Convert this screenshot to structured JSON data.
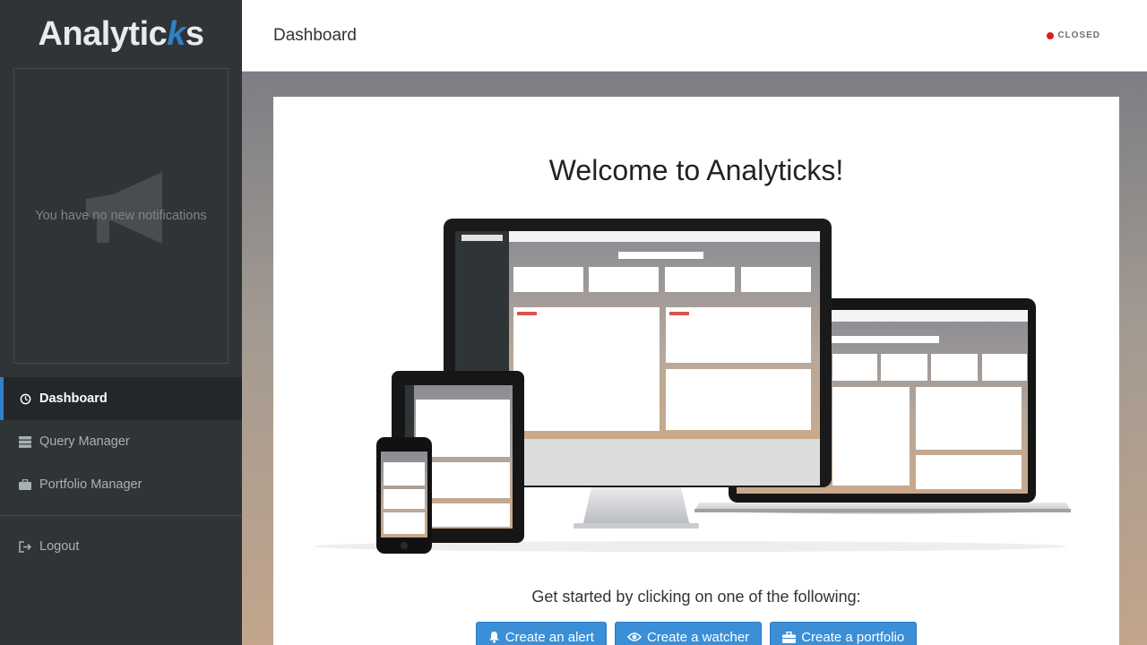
{
  "app": {
    "brand_main": "Analytic",
    "brand_accent": "k",
    "brand_tail": "s"
  },
  "sidebar": {
    "notifications_empty": "You have no new notifications",
    "items": [
      {
        "label": "Dashboard",
        "icon": "dashboard-icon",
        "active": true
      },
      {
        "label": "Query Manager",
        "icon": "server-icon",
        "active": false
      },
      {
        "label": "Portfolio Manager",
        "icon": "briefcase-icon",
        "active": false
      }
    ],
    "logout": {
      "label": "Logout",
      "icon": "logout-icon"
    }
  },
  "header": {
    "title": "Dashboard",
    "status": "CLOSED",
    "status_color": "#e01a1a"
  },
  "main": {
    "welcome": "Welcome to Analyticks!",
    "get_started": "Get started by clicking on one of the following:",
    "buttons": [
      {
        "label": "Create an alert",
        "icon": "bell-icon"
      },
      {
        "label": "Create a watcher",
        "icon": "eye-icon"
      },
      {
        "label": "Create a portfolio",
        "icon": "briefcase-icon"
      }
    ]
  },
  "colors": {
    "accent": "#2f80c9",
    "button": "#3a8fd6",
    "sidebar_bg": "#2f3437"
  }
}
